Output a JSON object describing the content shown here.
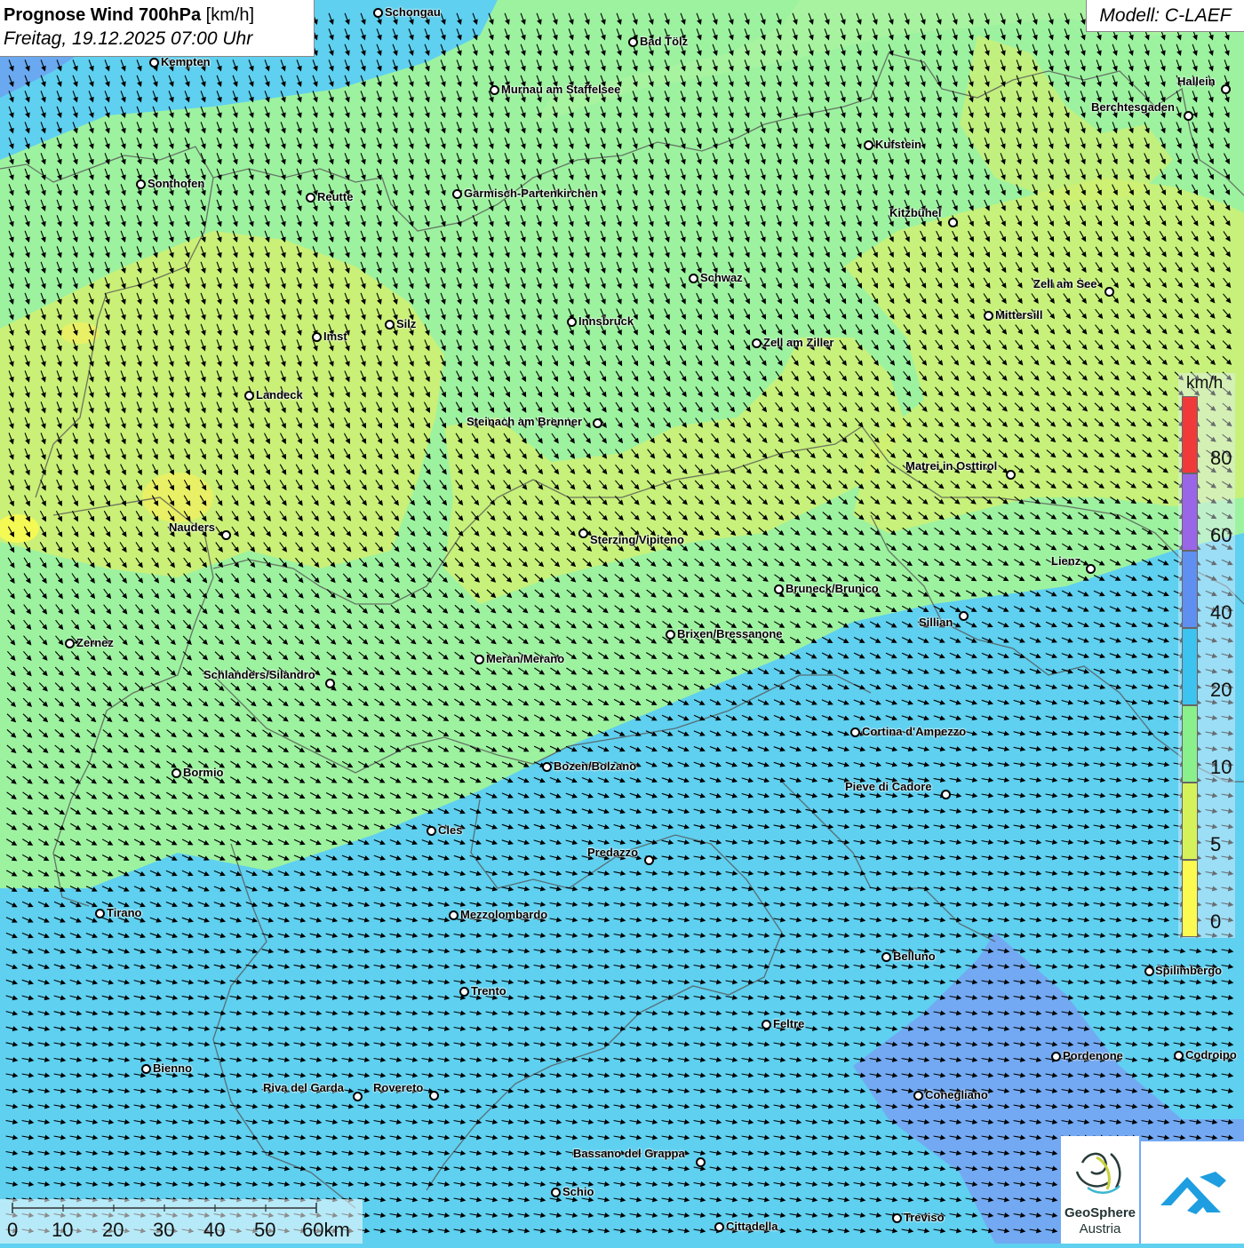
{
  "header": {
    "title_bold": "Prognose Wind 700hPa",
    "title_unit": "[km/h]",
    "datetime": "Freitag, 19.12.2025 07:00 Uhr",
    "model": "Modell: C-LAEF"
  },
  "legend": {
    "unit": "km/h",
    "ticks": [
      "80",
      "60",
      "40",
      "20",
      "10",
      "5",
      "0"
    ],
    "colors": [
      "#f03a3a",
      "#9a66e8",
      "#5f8ff0",
      "#3cc3f0",
      "#8af08c",
      "#d6f25a",
      "#fafa50"
    ]
  },
  "scale_bar": {
    "labels": [
      "0",
      "10",
      "20",
      "30",
      "40",
      "50",
      "60km"
    ]
  },
  "logo": {
    "name": "GeoSphere",
    "sub": "Austria"
  },
  "cities": [
    {
      "name": "Schongau"
    },
    {
      "name": "Bad Tölz"
    },
    {
      "name": "Kempten"
    },
    {
      "name": "Murnau am Staffelsee"
    },
    {
      "name": "Hallein"
    },
    {
      "name": "Berchtesgaden"
    },
    {
      "name": "Kufstein"
    },
    {
      "name": "Sonthofen"
    },
    {
      "name": "Reutte"
    },
    {
      "name": "Garmisch-Partenkirchen"
    },
    {
      "name": "Kitzbühel"
    },
    {
      "name": "Schwaz"
    },
    {
      "name": "Zell am See"
    },
    {
      "name": "Mittersill"
    },
    {
      "name": "Silz"
    },
    {
      "name": "Innsbruck"
    },
    {
      "name": "Imst"
    },
    {
      "name": "Zell am Ziller"
    },
    {
      "name": "Landeck"
    },
    {
      "name": "Steinach am Brenner"
    },
    {
      "name": "Matrei in Osttirol"
    },
    {
      "name": "Nauders"
    },
    {
      "name": "Sterzing/Vipiteno"
    },
    {
      "name": "Lienz"
    },
    {
      "name": "Bruneck/Brunico"
    },
    {
      "name": "Sillian"
    },
    {
      "name": "Brixen/Bressanone"
    },
    {
      "name": "Zernez"
    },
    {
      "name": "Meran/Merano"
    },
    {
      "name": "Schlanders/Silandro"
    },
    {
      "name": "Cortina d'Ampezzo"
    },
    {
      "name": "Bozen/Bolzano"
    },
    {
      "name": "Bormio"
    },
    {
      "name": "Pieve di Cadore"
    },
    {
      "name": "Cles"
    },
    {
      "name": "Predazzo"
    },
    {
      "name": "Tirano"
    },
    {
      "name": "Mezzolombardo"
    },
    {
      "name": "Belluno"
    },
    {
      "name": "Spilimbergo"
    },
    {
      "name": "Trento"
    },
    {
      "name": "Feltre"
    },
    {
      "name": "Pordenone"
    },
    {
      "name": "Codroipo"
    },
    {
      "name": "Bienno"
    },
    {
      "name": "Riva del Garda"
    },
    {
      "name": "Rovereto"
    },
    {
      "name": "Conegliano"
    },
    {
      "name": "Bassano del Grappa"
    },
    {
      "name": "Schio"
    },
    {
      "name": "Treviso"
    },
    {
      "name": "Cittadella"
    }
  ]
}
